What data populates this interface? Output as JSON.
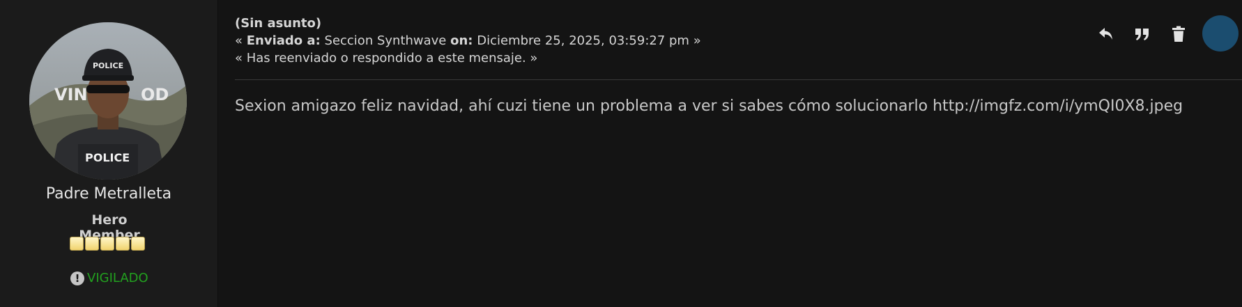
{
  "poster": {
    "username": "Padre Metralleta",
    "rank": "Hero Member",
    "stars": 5,
    "warning_label": "VIGILADO",
    "warning_color": "#22a11f",
    "avatar_icon": "police-character-avatar"
  },
  "message": {
    "subject": "(Sin asunto)",
    "meta_prefix": "«",
    "sent_to_label": "Enviado a:",
    "recipient": "Seccion Synthwave",
    "on_label": "on:",
    "date": "Diciembre 25, 2025, 03:59:27 pm",
    "meta_suffix": "»",
    "replied_note": "« Has reenviado o respondido a este mensaje. »",
    "body": "Sexion amigazo feliz navidad, ahí cuzi tiene un problema a ver si sabes cómo solucionarlo http://imgfz.com/i/ymQI0X8.jpeg"
  },
  "actions": {
    "reply_icon": "reply-icon",
    "quote_icon": "quote-icon",
    "delete_icon": "trash-icon",
    "select_color": "#1b4d6f"
  },
  "colors": {
    "background": "#141414",
    "sidebar": "#1b1b1b",
    "text": "#d6d6d6"
  }
}
